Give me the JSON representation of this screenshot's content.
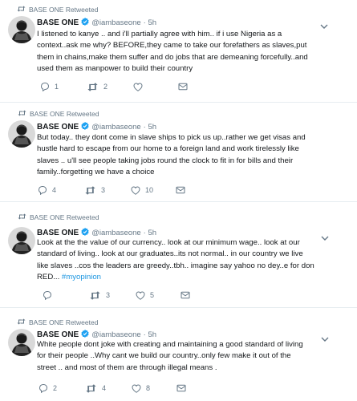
{
  "tweets": [
    {
      "retweet_label": "BASE ONE Retweeted",
      "name": "BASE ONE",
      "handle": "@iambaseone",
      "time": "· 5h",
      "lines": [
        "I listened to kanye .. and i'll partially agree with him.. if i use Nigeria as a",
        "context..ask me why? BEFORE,they came to take our forefathers as slaves,put",
        "them in chains,make them suffer and do jobs that are demeaning forcefully..and",
        "used them as manpower to build their country"
      ],
      "hashtag": "",
      "reply_count": "1",
      "retweet_count": "2",
      "like_count": ""
    },
    {
      "retweet_label": "BASE ONE Retweeted",
      "name": "BASE ONE",
      "handle": "@iambaseone",
      "time": "· 5h",
      "lines": [
        "But today.. they dont come in slave ships to pick us up..rather we get visas and",
        "hustle hard to escape from our home to a foreign land and work tirelessly like",
        "slaves .. u'll see people taking jobs round the clock to fit in for bills and their",
        "family..forgetting we have a choice"
      ],
      "hashtag": "",
      "reply_count": "4",
      "retweet_count": "3",
      "like_count": "10"
    },
    {
      "retweet_label": "BASE ONE Retweeted",
      "name": "BASE ONE",
      "handle": "@iambaseone",
      "time": "· 5h",
      "lines": [
        "Look at the the value of our currency.. look at our minimum wage.. look at our",
        "standard of living.. look at our graduates..its not normal.. in our country we live",
        "like slaves ..cos the leaders are greedy..tbh.. imagine say yahoo no dey..e for don",
        "RED... "
      ],
      "hashtag": "#myopinion",
      "reply_count": "",
      "retweet_count": "3",
      "like_count": "5"
    },
    {
      "retweet_label": "BASE ONE Retweeted",
      "name": "BASE ONE",
      "handle": "@iambaseone",
      "time": "· 5h",
      "lines": [
        "White people dont joke with creating and maintaining a good standard of living",
        "for their people ..Why cant we build our country..only few make it out of the",
        "street .. and most of them are through illegal means ."
      ],
      "hashtag": "",
      "reply_count": "2",
      "retweet_count": "4",
      "like_count": "8"
    }
  ],
  "icons": {
    "retweeted": "retweet-icon",
    "verified": "verified-badge-icon",
    "reply": "reply-icon",
    "retweet": "retweet-icon",
    "like": "heart-icon",
    "message": "envelope-icon",
    "more": "chevron-down-icon"
  },
  "colors": {
    "text": "#14171a",
    "muted": "#657786",
    "accent": "#1b95e0",
    "separator": "#e6ecf0"
  }
}
